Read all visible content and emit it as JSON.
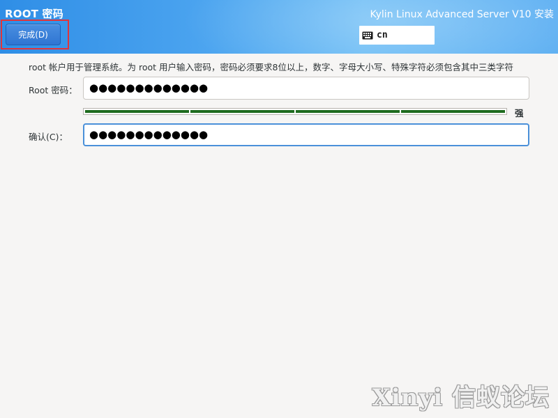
{
  "header": {
    "spoke_title": "ROOT 密码",
    "done_label": "完成(D)",
    "product_title": "Kylin Linux Advanced Server V10 安装",
    "keyboard_layout": "cn"
  },
  "form": {
    "instruction": "root 帐户用于管理系统。为 root 用户输入密码，密码必须要求8位以上，数字、字母大小写、特殊字符必须包含其中三类字符",
    "password_label": "Root 密码：",
    "password_value": "●●●●●●●●●●●●●",
    "confirm_label": "确认(C)：",
    "confirm_value": "●●●●●●●●●●●●●",
    "strength": {
      "label": "强",
      "filled_segments": 4,
      "total_segments": 4
    }
  },
  "watermark": {
    "text": "Xinyi 信蚁论坛"
  },
  "colors": {
    "header_blue": "#2f8ee6",
    "accent_button": "#2f75d2",
    "strength_fill": "#1e6b1e",
    "highlight_border": "#e0343a"
  }
}
